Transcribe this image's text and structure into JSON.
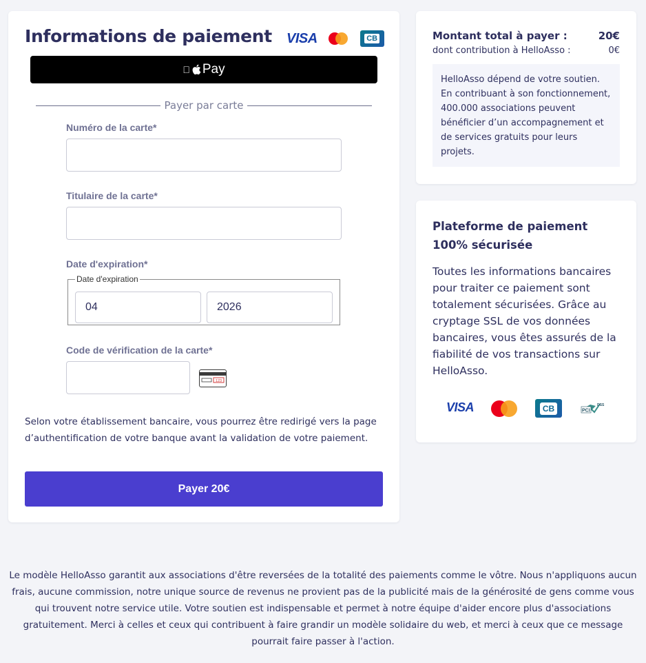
{
  "payment": {
    "title": "Informations de paiement",
    "brands": {
      "visa": "VISA",
      "cb": "CB"
    },
    "apple_pay_label": "Pay",
    "divider_text": "Payer par carte",
    "card_number_label": "Numéro de la carte*",
    "card_number_value": "",
    "holder_label": "Titulaire de la carte*",
    "holder_value": "",
    "expiry_label": "Date d'expiration*",
    "expiry_legend": "Date d'expiration",
    "expiry_month": "04",
    "expiry_year": "2026",
    "cvc_label": "Code de vérification de la carte*",
    "cvc_value": "",
    "cvc_icon_text": "123",
    "note": "Selon votre établissement bancaire, vous pourrez être redirigé vers la page d’authentification de votre banque avant la validation de votre paiement.",
    "pay_button": "Payer 20€",
    "colors": {
      "primary": "#4a3ecf",
      "text": "#2e2f5e",
      "label": "#6f7193"
    }
  },
  "summary": {
    "total_label": "Montant total à payer :",
    "total_value": "20€",
    "contribution_label": "dont contribution à HelloAsso :",
    "contribution_value": "0€",
    "support_text": "HelloAsso dépend de votre soutien. En contribuant à son fonctionnement, 400.000 associations peuvent bénéficier d’un accompagnement et de services gratuits pour leurs projets."
  },
  "security": {
    "title": "Plateforme de paiement 100% sécurisée",
    "text": "Toutes les informations bancaires pour traiter ce paiement sont totalement sécurisées. Grâce au cryptage SSL de vos données bancaires, vous êtes assurés de la fiabilité de vos transactions sur HelloAsso.",
    "logos": {
      "visa": "VISA",
      "cb": "CB",
      "pci": "PCI",
      "dss": "DSS"
    }
  },
  "footer": {
    "text": "Le modèle HelloAsso garantit aux associations d'être reversées de la totalité des paiements comme le vôtre. Nous n'appliquons aucun frais, aucune commission, notre unique source de revenus ne provient pas de la publicité mais de la générosité de gens comme vous qui trouvent notre service utile. Votre soutien est indispensable et permet à notre équipe d'aider encore plus d'associations gratuitement. Merci à celles et ceux qui contribuent à faire grandir un modèle solidaire du web, et merci à ceux que ce message pourrait faire passer à l'action."
  }
}
